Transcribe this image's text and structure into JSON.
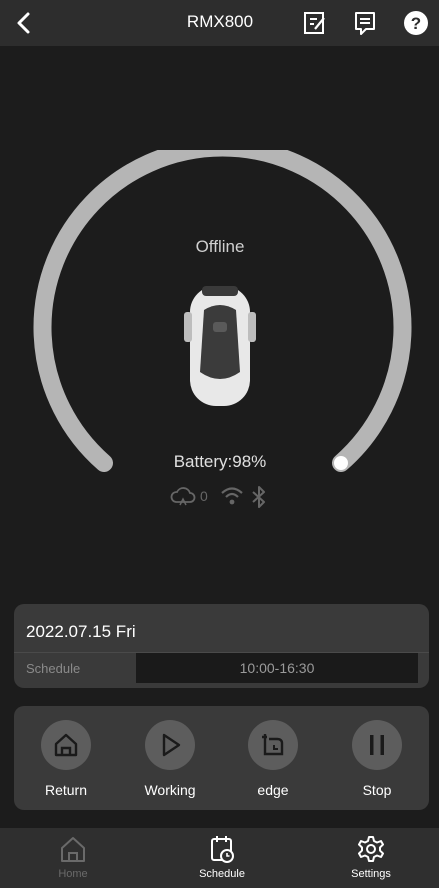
{
  "header": {
    "title": "RMX800"
  },
  "device": {
    "status": "Offline",
    "battery_label": "Battery:98%",
    "battery_percent": 98,
    "cloud_count": "0"
  },
  "schedule": {
    "date": "2022.07.15 Fri",
    "label": "Schedule",
    "time_range": "10:00-16:30"
  },
  "controls": [
    {
      "label": "Return",
      "icon": "home-icon"
    },
    {
      "label": "Working",
      "icon": "play-icon"
    },
    {
      "label": "edge",
      "icon": "edge-icon"
    },
    {
      "label": "Stop",
      "icon": "pause-icon"
    }
  ],
  "tabs": [
    {
      "label": "Home",
      "icon": "home-outline-icon",
      "active": false
    },
    {
      "label": "Schedule",
      "icon": "calendar-clock-icon",
      "active": true
    },
    {
      "label": "Settings",
      "icon": "gear-icon",
      "active": true
    }
  ],
  "colors": {
    "background": "#1c1c1c",
    "card": "#3a3a3a",
    "gauge": "#b5b5b5",
    "inactive_tab": "#6a6a6a"
  }
}
